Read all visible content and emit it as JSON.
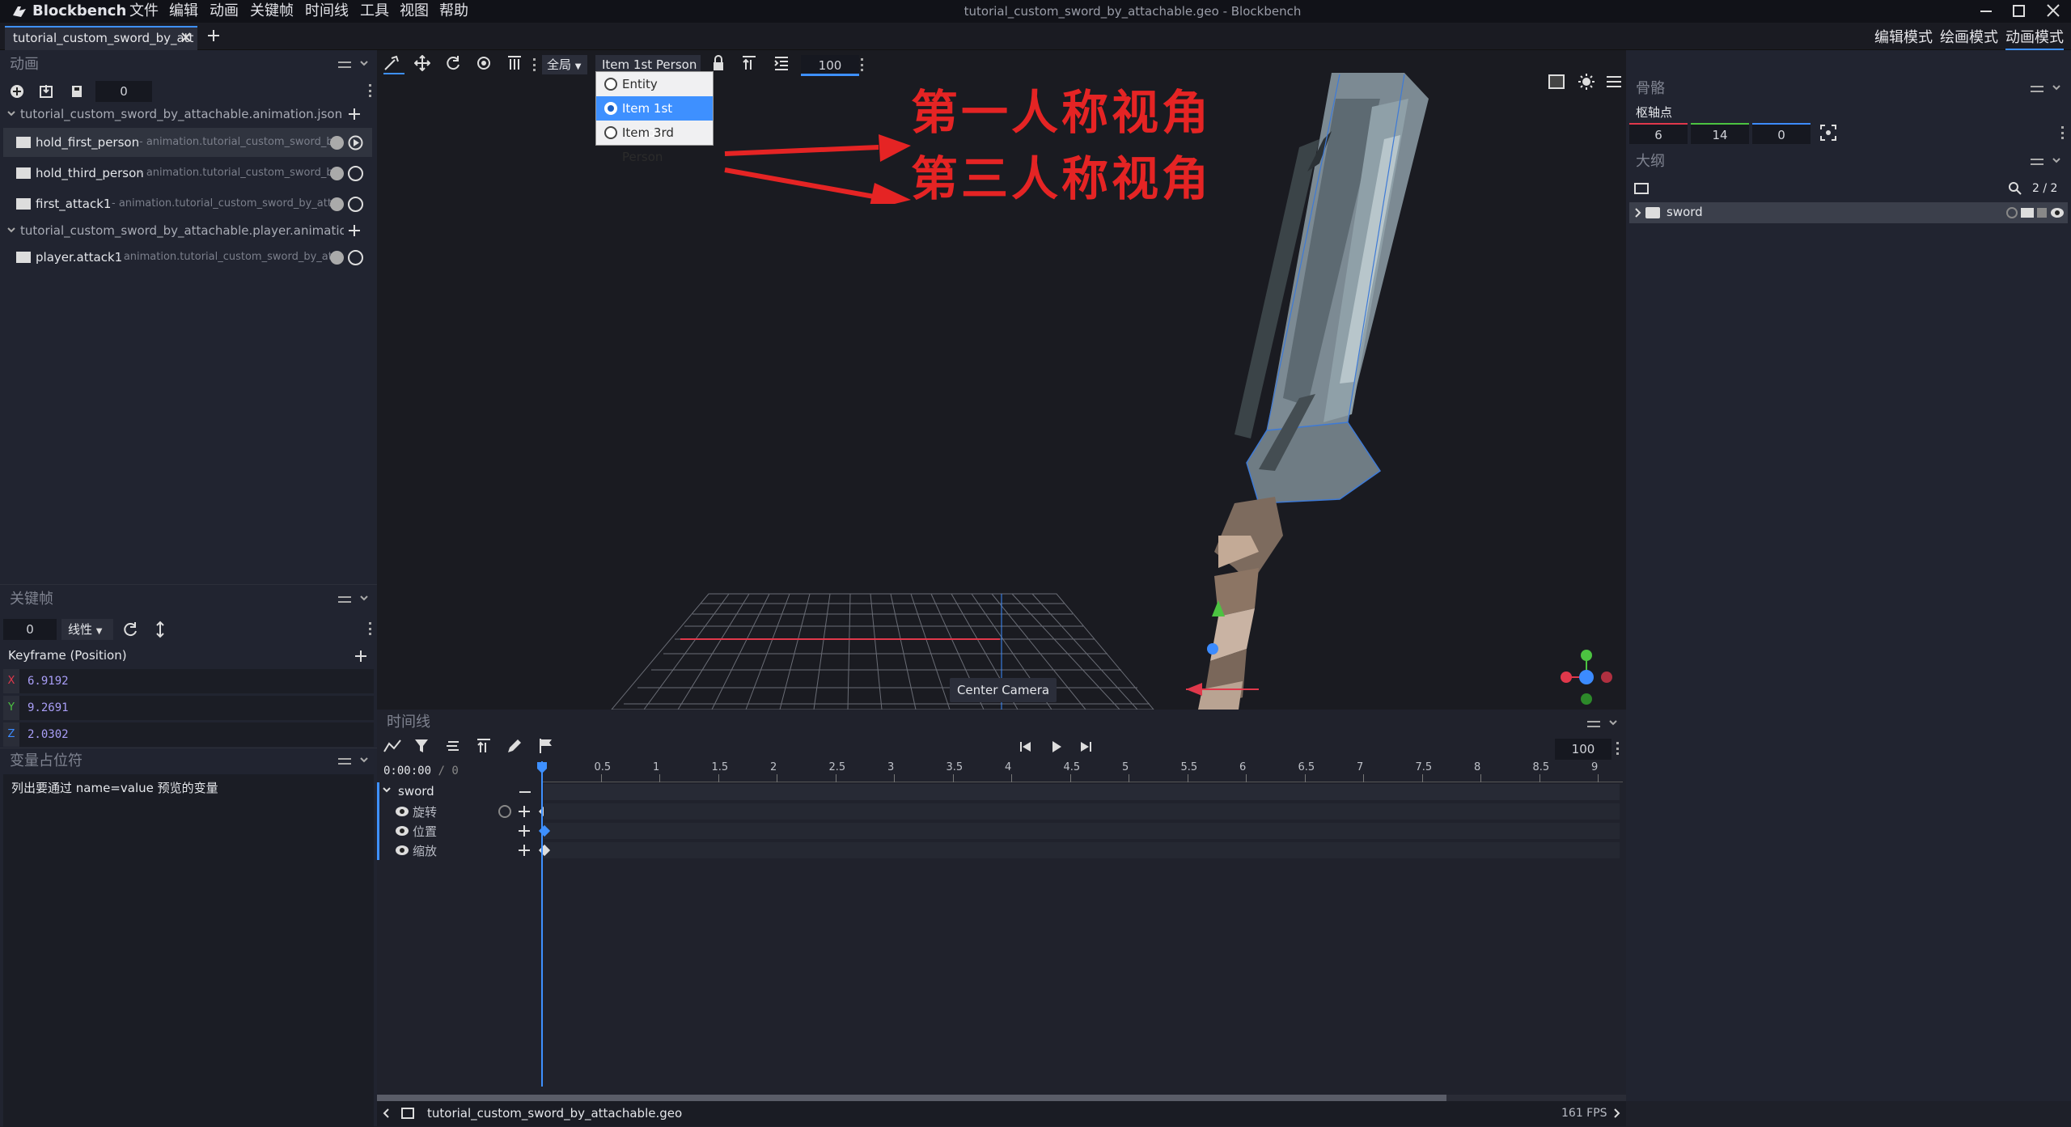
{
  "app": {
    "name": "Blockbench",
    "window_title": "tutorial_custom_sword_by_attachable.geo - Blockbench"
  },
  "menu": [
    "文件",
    "编辑",
    "动画",
    "关键帧",
    "时间线",
    "工具",
    "视图",
    "帮助"
  ],
  "file_tab": "tutorial_custom_sword_by_att",
  "modes": {
    "edit": "编辑模式",
    "paint": "绘画模式",
    "animate": "动画模式"
  },
  "animations_panel": {
    "title": "动画",
    "counter": "0",
    "files": [
      {
        "name": "tutorial_custom_sword_by_attachable.animation.json",
        "items": [
          {
            "name": "hold_first_person",
            "path": "- animation.tutorial_custom_sword_by_",
            "selected": true
          },
          {
            "name": "hold_third_person",
            "path": "- animation.tutorial_custom_sword_by",
            "selected": false
          },
          {
            "name": "first_attack1",
            "path": "- animation.tutorial_custom_sword_by_attac",
            "selected": false
          }
        ]
      },
      {
        "name": "tutorial_custom_sword_by_attachable.player.animation.json",
        "items": [
          {
            "name": "player.attack1",
            "path": "- animation.tutorial_custom_sword_by_atta",
            "selected": false
          }
        ]
      }
    ]
  },
  "keyframe_panel": {
    "title": "关键帧",
    "time": "0",
    "interpolation": "线性",
    "label": "Keyframe (Position)",
    "axes": [
      {
        "axis": "X",
        "value": "6.9192",
        "color": "#e0384b"
      },
      {
        "axis": "Y",
        "value": "9.2691",
        "color": "#4cc341"
      },
      {
        "axis": "Z",
        "value": "2.0302",
        "color": "#3c8bff"
      }
    ]
  },
  "variables_panel": {
    "title": "变量占位符",
    "text": "列出要通过 name=value 预览的变量"
  },
  "toolbar": {
    "space": "全局",
    "preview_mode": "Item 1st Person",
    "speed": "100"
  },
  "dropdown": {
    "options": [
      "Entity",
      "Item 1st Person",
      "Item 3rd Person"
    ],
    "selected": 1
  },
  "annotations": {
    "first": "第一人称视角",
    "third": "第三人称视角"
  },
  "center_camera": "Center Camera",
  "timeline": {
    "title": "时间线",
    "time": "0:00:00",
    "slash": "/",
    "frames": "0",
    "speed": "100",
    "ticks": [
      "0.5",
      "1",
      "1.5",
      "2",
      "2.5",
      "3",
      "3.5",
      "4",
      "4.5",
      "5",
      "5.5",
      "6",
      "6.5",
      "7",
      "7.5",
      "8",
      "8.5",
      "9"
    ],
    "bone": "sword",
    "channels": [
      "旋转",
      "位置",
      "缩放"
    ]
  },
  "right_panel": {
    "bone_title": "骨骼",
    "pivot_label": "枢轴点",
    "pivot": [
      "6",
      "14",
      "0"
    ],
    "outliner_title": "大纲",
    "count": "2 / 2",
    "outliner_item": "sword"
  },
  "status": {
    "file": "tutorial_custom_sword_by_attachable.geo",
    "fps": "161 FPS"
  },
  "colors": {
    "accent": "#3e90ff",
    "annotation": "#e52424"
  }
}
